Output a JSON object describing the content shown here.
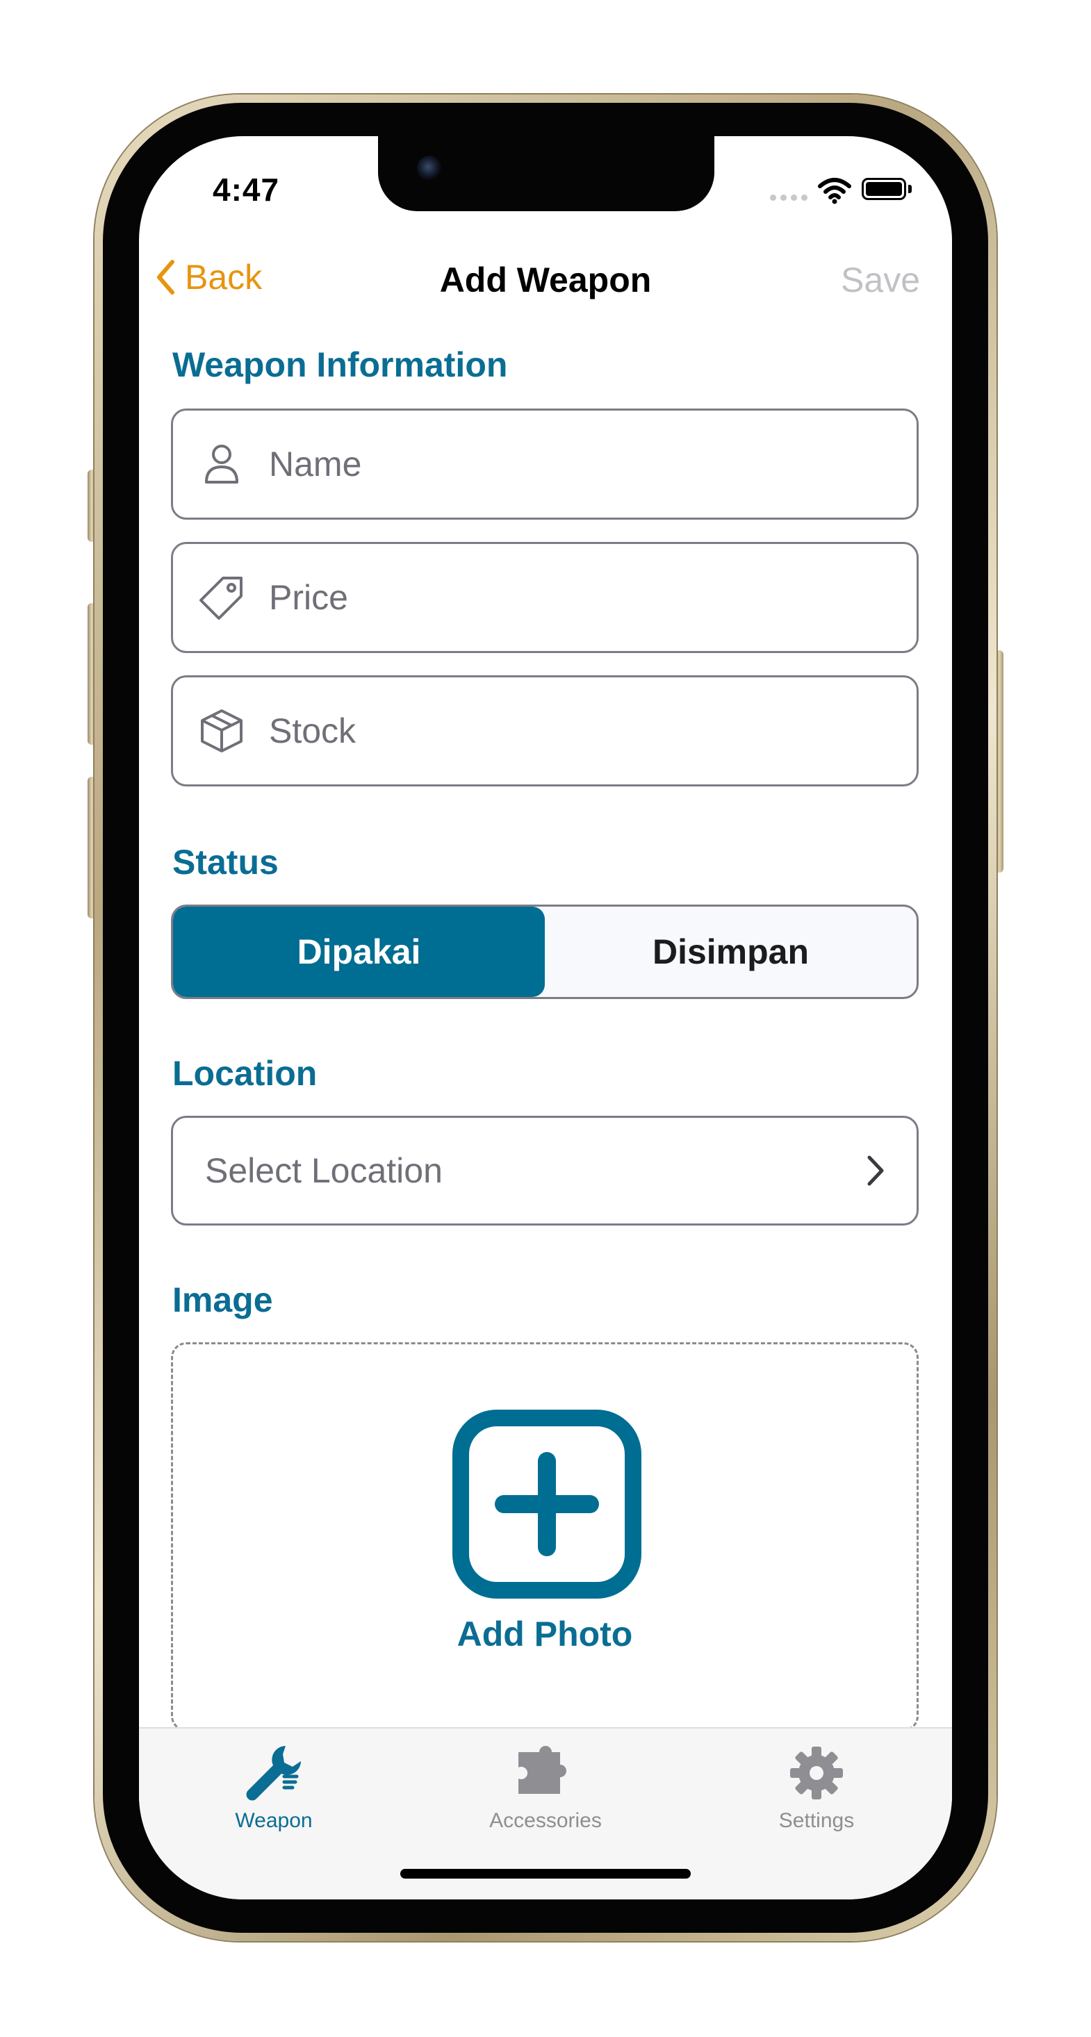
{
  "status_bar": {
    "time": "4:47"
  },
  "nav": {
    "back_label": "Back",
    "title": "Add Weapon",
    "save_label": "Save"
  },
  "sections": {
    "weapon_info": "Weapon Information",
    "status": "Status",
    "location": "Location",
    "image": "Image"
  },
  "fields": {
    "name_placeholder": "Name",
    "price_placeholder": "Price",
    "stock_placeholder": "Stock"
  },
  "status_segment": {
    "options": [
      "Dipakai",
      "Disimpan"
    ],
    "selected": "Dipakai"
  },
  "location": {
    "placeholder": "Select Location"
  },
  "image": {
    "add_label": "Add Photo"
  },
  "tabbar": {
    "items": [
      {
        "label": "Weapon",
        "icon": "wrench-icon",
        "active": true
      },
      {
        "label": "Accessories",
        "icon": "puzzle-icon",
        "active": false
      },
      {
        "label": "Settings",
        "icon": "gear-icon",
        "active": false
      }
    ]
  },
  "colors": {
    "accent": "#0a6d93",
    "back": "#e8940f",
    "disabled": "#c0c0c6"
  }
}
